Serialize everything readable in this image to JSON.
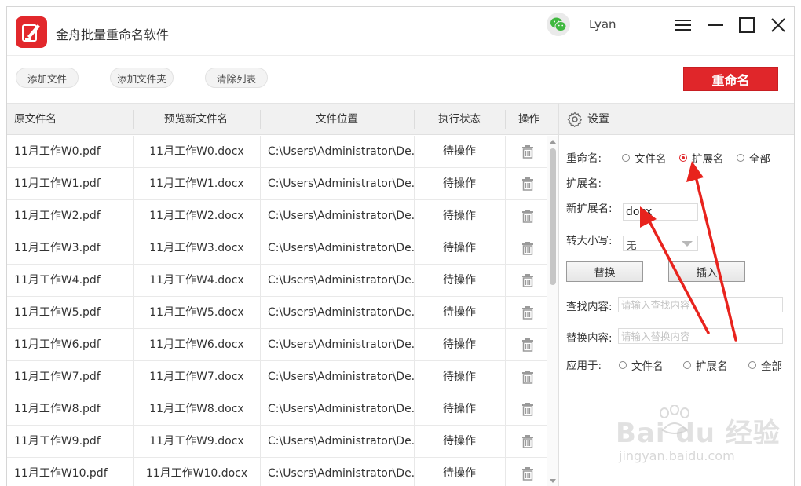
{
  "app": {
    "title": "金舟批量重命名软件",
    "username": "Lyan"
  },
  "toolbar": {
    "add_file": "添加文件",
    "add_folder": "添加文件夹",
    "clear_list": "清除列表",
    "rename": "重命名"
  },
  "table": {
    "headers": [
      "原文件名",
      "预览新文件名",
      "文件位置",
      "执行状态",
      "操作"
    ],
    "rows": [
      {
        "original": "11月工作W0.pdf",
        "preview": "11月工作W0.docx",
        "location": "C:\\Users\\Administrator\\De...",
        "status": "待操作"
      },
      {
        "original": "11月工作W1.pdf",
        "preview": "11月工作W1.docx",
        "location": "C:\\Users\\Administrator\\De...",
        "status": "待操作"
      },
      {
        "original": "11月工作W2.pdf",
        "preview": "11月工作W2.docx",
        "location": "C:\\Users\\Administrator\\De...",
        "status": "待操作"
      },
      {
        "original": "11月工作W3.pdf",
        "preview": "11月工作W3.docx",
        "location": "C:\\Users\\Administrator\\De...",
        "status": "待操作"
      },
      {
        "original": "11月工作W4.pdf",
        "preview": "11月工作W4.docx",
        "location": "C:\\Users\\Administrator\\De...",
        "status": "待操作"
      },
      {
        "original": "11月工作W5.pdf",
        "preview": "11月工作W5.docx",
        "location": "C:\\Users\\Administrator\\De...",
        "status": "待操作"
      },
      {
        "original": "11月工作W6.pdf",
        "preview": "11月工作W6.docx",
        "location": "C:\\Users\\Administrator\\De...",
        "status": "待操作"
      },
      {
        "original": "11月工作W7.pdf",
        "preview": "11月工作W7.docx",
        "location": "C:\\Users\\Administrator\\De...",
        "status": "待操作"
      },
      {
        "original": "11月工作W8.pdf",
        "preview": "11月工作W8.docx",
        "location": "C:\\Users\\Administrator\\De...",
        "status": "待操作"
      },
      {
        "original": "11月工作W9.pdf",
        "preview": "11月工作W9.docx",
        "location": "C:\\Users\\Administrator\\De...",
        "status": "待操作"
      },
      {
        "original": "11月工作W10.pdf",
        "preview": "11月工作W10.docx",
        "location": "C:\\Users\\Administrator\\De...",
        "status": "待操作"
      }
    ]
  },
  "settings": {
    "title": "设置",
    "rename_label": "重命名:",
    "rename_options": [
      "文件名",
      "扩展名",
      "全部"
    ],
    "rename_selected": "扩展名",
    "ext_label": "扩展名:",
    "new_ext_label": "新扩展名:",
    "new_ext_value": "docx",
    "case_label": "转大小写:",
    "case_value": "无",
    "replace_button": "替换",
    "insert_button": "插入",
    "find_label": "查找内容:",
    "find_placeholder": "请输入查找内容",
    "replace_label": "替换内容:",
    "replace_placeholder": "请输入替换内容",
    "apply_label": "应用于:",
    "apply_options": [
      "文件名",
      "扩展名",
      "全部"
    ]
  },
  "colors": {
    "accent": "#e0262a",
    "header_bg": "#f1f1f1",
    "annotation_arrow": "#e8231d"
  },
  "icons": {
    "logo": "rename-logo-icon",
    "wechat": "wechat-icon",
    "menu": "menu-icon",
    "minimize": "minimize-icon",
    "maximize": "maximize-icon",
    "close": "close-icon",
    "settings": "gear-icon",
    "delete": "trash-icon"
  },
  "watermark": {
    "main": "Bai du 经验",
    "sub": "jingyan.baidu.com"
  }
}
